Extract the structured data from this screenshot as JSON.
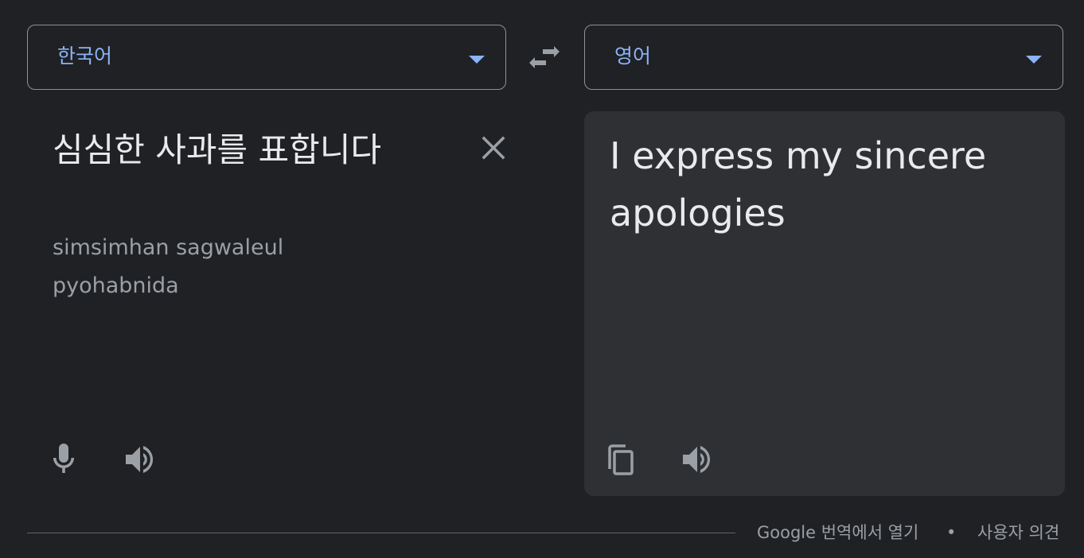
{
  "source_language": {
    "label": "한국어",
    "dropdown_icon": "chevron-down-icon"
  },
  "target_language": {
    "label": "영어",
    "dropdown_icon": "chevron-down-icon"
  },
  "swap_icon": "swap-arrows-icon",
  "source": {
    "text": "심심한 사과를 표합니다",
    "romanization": "simsimhan sagwaleul pyohabnida",
    "icons": [
      "close-icon",
      "microphone-icon",
      "speaker-icon"
    ]
  },
  "target": {
    "text": "I express my sincere apologies",
    "icons": [
      "copy-icon",
      "speaker-icon"
    ]
  },
  "footer": {
    "open_link": "Google 번역에서 열기",
    "separator": "•",
    "feedback_link": "사용자 의견"
  },
  "colors": {
    "background": "#202124",
    "accent": "#8ab4f8",
    "target_panel": "#2f3033",
    "icon": "#9aa0a6"
  }
}
